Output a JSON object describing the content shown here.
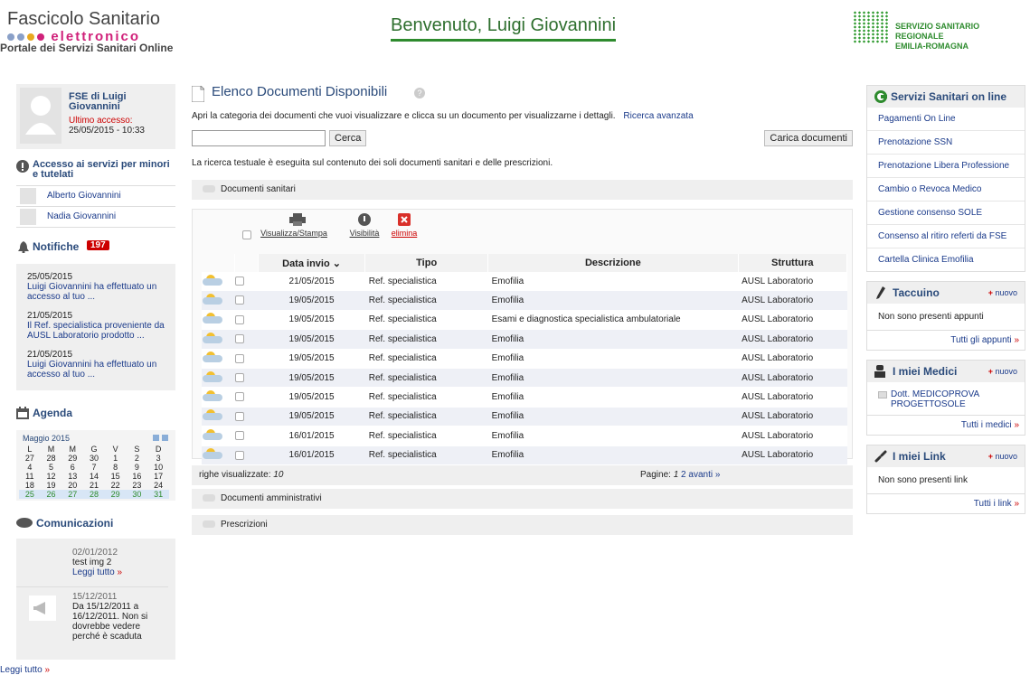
{
  "header": {
    "logo_line1": "Fascicolo Sanitario",
    "logo_line2": "elettronico",
    "logo_line3": "Portale dei Servizi Sanitari Online",
    "welcome": "Benvenuto, Luigi Giovannini",
    "region_line1": "SERVIZIO SANITARIO REGIONALE",
    "region_line2": "EMILIA-ROMAGNA"
  },
  "profile": {
    "name": "FSE di Luigi Giovannini",
    "last_access_label": "Ultimo accesso:",
    "last_access_value": "25/05/2015 - 10:33"
  },
  "minors": {
    "title": "Accesso ai servizi per minori e tutelati",
    "people": [
      "Alberto Giovannini",
      "Nadia Giovannini"
    ]
  },
  "notifications": {
    "title": "Notifiche",
    "count": "197",
    "items": [
      {
        "date": "25/05/2015",
        "text": "Luigi Giovannini ha effettuato un accesso al tuo ..."
      },
      {
        "date": "21/05/2015",
        "text": "Il Ref. specialistica proveniente da AUSL Laboratorio prodotto ..."
      },
      {
        "date": "21/05/2015",
        "text": "Luigi Giovannini ha effettuato un accesso al tuo ..."
      }
    ]
  },
  "agenda": {
    "title": "Agenda",
    "month": "Maggio 2015",
    "days": [
      "L",
      "M",
      "M",
      "G",
      "V",
      "S",
      "D"
    ],
    "weeks": [
      [
        "27",
        "28",
        "29",
        "30",
        "1",
        "2",
        "3"
      ],
      [
        "4",
        "5",
        "6",
        "7",
        "8",
        "9",
        "10"
      ],
      [
        "11",
        "12",
        "13",
        "14",
        "15",
        "16",
        "17"
      ],
      [
        "18",
        "19",
        "20",
        "21",
        "22",
        "23",
        "24"
      ],
      [
        "25",
        "26",
        "27",
        "28",
        "29",
        "30",
        "31"
      ]
    ]
  },
  "comunicazioni": {
    "title": "Comunicazioni",
    "items": [
      {
        "date": "02/01/2012",
        "text": "test img 2",
        "link": "Leggi tutto"
      },
      {
        "date": "15/12/2011",
        "text": "Da 15/12/2011 a 16/12/2011. Non si dovrebbe vedere perché è scaduta",
        "link": "Leggi tutto"
      }
    ]
  },
  "main": {
    "title": "Elenco Documenti Disponibili",
    "intro": "Apri la categoria dei documenti che vuoi visualizzare e clicca su un documento per visualizzarne i dettagli.",
    "advanced_search": "Ricerca avanzata",
    "search_placeholder": "",
    "search_button": "Cerca",
    "upload_button": "Carica documenti",
    "search_note": "La ricerca testuale è eseguita sul contenuto dei soli documenti sanitari e delle prescrizioni.",
    "section_sanitari": "Documenti sanitari",
    "actions": {
      "print": "Visualizza/Stampa",
      "visibility": "Visibilità",
      "delete": "elimina"
    },
    "columns": [
      "Data invio",
      "Tipo",
      "Descrizione",
      "Struttura"
    ],
    "rows": [
      [
        "21/05/2015",
        "Ref. specialistica",
        "Emofilia",
        "AUSL Laboratorio"
      ],
      [
        "19/05/2015",
        "Ref. specialistica",
        "Emofilia",
        "AUSL Laboratorio"
      ],
      [
        "19/05/2015",
        "Ref. specialistica",
        "Esami e diagnostica specialistica ambulatoriale",
        "AUSL Laboratorio"
      ],
      [
        "19/05/2015",
        "Ref. specialistica",
        "Emofilia",
        "AUSL Laboratorio"
      ],
      [
        "19/05/2015",
        "Ref. specialistica",
        "Emofilia",
        "AUSL Laboratorio"
      ],
      [
        "19/05/2015",
        "Ref. specialistica",
        "Emofilia",
        "AUSL Laboratorio"
      ],
      [
        "19/05/2015",
        "Ref. specialistica",
        "Emofilia",
        "AUSL Laboratorio"
      ],
      [
        "19/05/2015",
        "Ref. specialistica",
        "Emofilia",
        "AUSL Laboratorio"
      ],
      [
        "16/01/2015",
        "Ref. specialistica",
        "Emofilia",
        "AUSL Laboratorio"
      ],
      [
        "16/01/2015",
        "Ref. specialistica",
        "Emofilia",
        "AUSL Laboratorio"
      ]
    ],
    "rows_label": "righe visualizzate:",
    "rows_value": "10",
    "pages_label": "Pagine:",
    "page1": "1",
    "page2": "2",
    "next": "avanti",
    "section_amministrativi": "Documenti amministrativi",
    "section_prescrizioni": "Prescrizioni"
  },
  "services": {
    "title": "Servizi Sanitari on line",
    "links": [
      "Pagamenti On Line",
      "Prenotazione SSN",
      "Prenotazione Libera Professione",
      "Cambio o Revoca Medico",
      "Gestione consenso SOLE",
      "Consenso al ritiro referti da FSE",
      "Cartella Clinica Emofilia"
    ]
  },
  "taccuino": {
    "title": "Taccuino",
    "new": "nuovo",
    "empty": "Non sono presenti appunti",
    "all": "Tutti gli appunti"
  },
  "medici": {
    "title": "I miei Medici",
    "new": "nuovo",
    "doctor": "Dott. MEDICOPROVA PROGETTOSOLE",
    "all": "Tutti i medici"
  },
  "links": {
    "title": "I miei Link",
    "new": "nuovo",
    "empty": "Non sono presenti link",
    "all": "Tutti i link"
  },
  "colors": {
    "accent_green": "#2e8b2e",
    "title_blue": "#2a4a7a",
    "badge_red": "#c00"
  }
}
